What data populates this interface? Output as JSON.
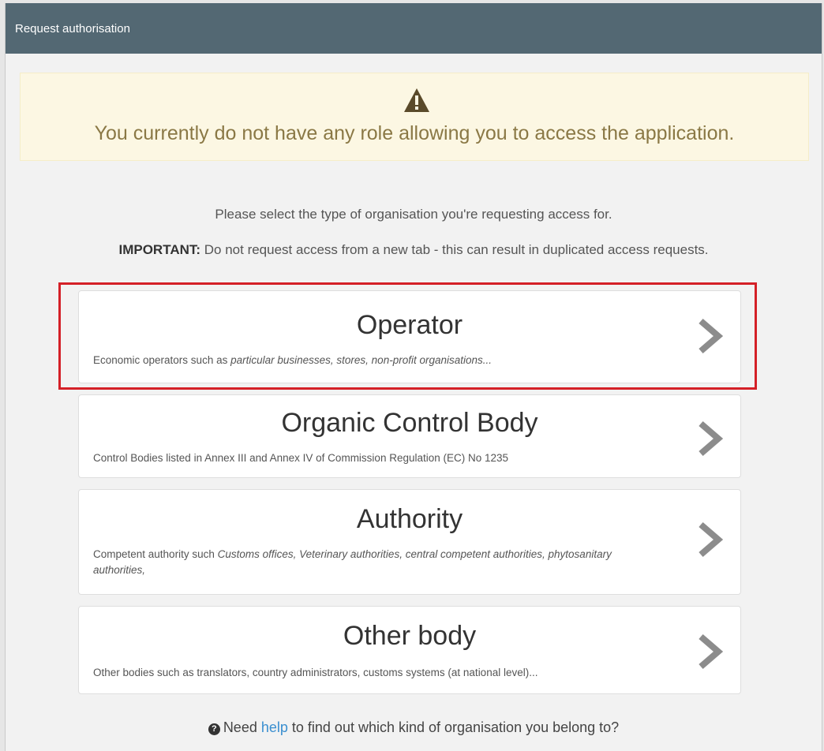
{
  "header": {
    "title": "Request authorisation"
  },
  "alert": {
    "icon": "warning-icon",
    "message": "You currently do not have any role allowing you to access the application."
  },
  "intro": "Please select the type of organisation you're requesting access for.",
  "important": {
    "label": "IMPORTANT:",
    "text": " Do not request access from a new tab - this can result in duplicated access requests."
  },
  "options": [
    {
      "title": "Operator",
      "desc_prefix": "Economic operators such as ",
      "desc_italic": "particular businesses, stores, non-profit organisations...",
      "highlighted": true
    },
    {
      "title": "Organic Control Body",
      "desc": "Control Bodies listed in Annex III and Annex IV of Commission Regulation (EC) No 1235"
    },
    {
      "title": "Authority",
      "desc_prefix": "Competent authority such ",
      "desc_italic": "Customs offices, Veterinary authorities, central competent authorities, phytosanitary authorities,"
    },
    {
      "title": "Other body",
      "desc": "Other bodies such as translators, country administrators, customs systems (at national level)..."
    }
  ],
  "help": {
    "icon": "question-circle-icon",
    "before": "Need ",
    "link": "help",
    "after": " to find out which kind of organisation you belong to?"
  },
  "colors": {
    "header_bg": "#536873",
    "alert_bg": "#fcf7e3",
    "alert_text": "#8a7845",
    "highlight_border": "#d42027",
    "link": "#3a8fd0"
  }
}
